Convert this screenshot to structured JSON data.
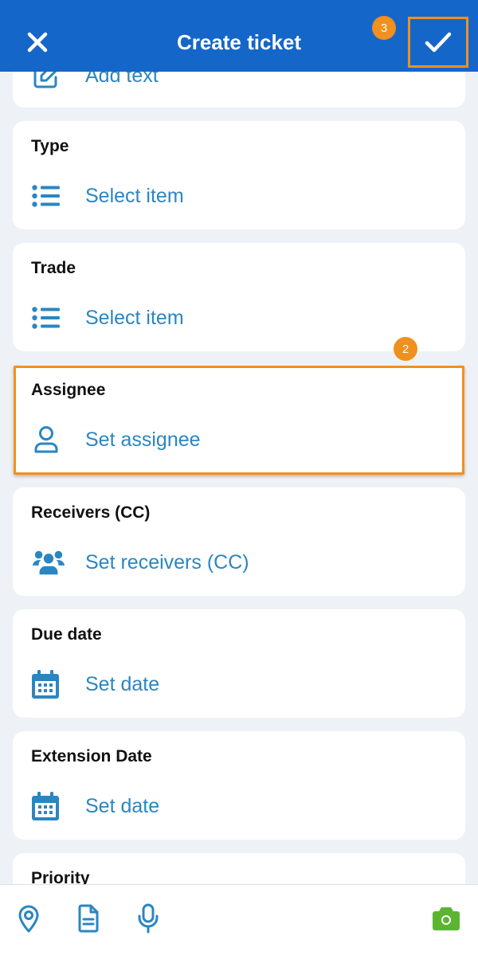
{
  "header": {
    "title": "Create ticket",
    "close_icon": "close-icon",
    "confirm_icon": "check-icon",
    "step_badge": "3"
  },
  "cards": {
    "description": {
      "label": "Add text",
      "icon": "edit-icon"
    },
    "type": {
      "title": "Type",
      "label": "Select item",
      "icon": "list-icon"
    },
    "trade": {
      "title": "Trade",
      "label": "Select item",
      "icon": "list-icon"
    },
    "assignee": {
      "title": "Assignee",
      "label": "Set assignee",
      "icon": "user-icon",
      "step_badge": "2"
    },
    "receivers": {
      "title": "Receivers (CC)",
      "label": "Set receivers (CC)",
      "icon": "users-icon"
    },
    "due_date": {
      "title": "Due date",
      "label": "Set date",
      "icon": "calendar-icon"
    },
    "extension_date": {
      "title": "Extension Date",
      "label": "Set date",
      "icon": "calendar-icon"
    },
    "priority": {
      "title": "Priority"
    }
  },
  "bottom_bar": {
    "icons": [
      "location-pin-icon",
      "document-icon",
      "microphone-icon",
      "camera-icon"
    ]
  },
  "colors": {
    "header_bg": "#1467c8",
    "accent": "#2a86c2",
    "highlight": "#f0901e",
    "camera": "#5cb531",
    "background": "#eef2f6"
  }
}
